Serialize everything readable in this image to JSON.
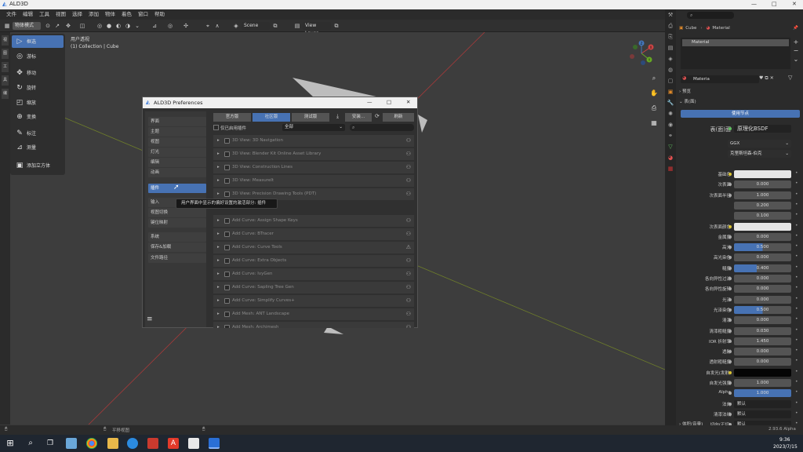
{
  "app": {
    "title": "ALD3D",
    "win_controls": [
      "—",
      "□",
      "✕"
    ]
  },
  "menubar": [
    "文件",
    "编辑",
    "工具",
    "视图",
    "选择",
    "添加",
    "物体",
    "着色",
    "窗口",
    "帮助"
  ],
  "header": {
    "mode": "物体模式",
    "view": "视图",
    "select": "选择",
    "add": "添加",
    "scene": "Scene",
    "view_layer": "View Layer"
  },
  "left_strip": [
    "视",
    "图",
    "工",
    "具",
    "编"
  ],
  "toolbar": [
    {
      "label": "框选",
      "icon": "▷",
      "active": true
    },
    {
      "label": "游标",
      "icon": "◎"
    },
    {
      "label": "移动",
      "icon": "✥"
    },
    {
      "label": "旋转",
      "icon": "↻"
    },
    {
      "label": "缩放",
      "icon": "◰"
    },
    {
      "label": "变换",
      "icon": "⊕"
    },
    {
      "label": "标注",
      "icon": "✎"
    },
    {
      "label": "测量",
      "icon": "⊿"
    },
    {
      "label": "添加立方体",
      "icon": "▣"
    }
  ],
  "viewport": {
    "view_name": "用户透视",
    "collection": "(1) Collection | Cube"
  },
  "gizmo": {
    "x": "X",
    "y": "Y",
    "z": "Z"
  },
  "dialog": {
    "title": "ALD3D Preferences",
    "tabs": [
      "官方版",
      "社区版",
      "测试版"
    ],
    "active_tab": 1,
    "install": "安装...",
    "refresh": "刷新",
    "enabled_only": "仅已启用插件",
    "category": "全部",
    "search_placeholder": "",
    "nav": [
      [
        "界面",
        "主题",
        "视图",
        "灯光",
        "编辑",
        "动画"
      ],
      [
        "插件"
      ],
      [
        "输入",
        "视图切换",
        "键位映射"
      ],
      [
        "系统",
        "保存&加载",
        "文件路径"
      ]
    ],
    "addons": [
      "3D View: 3D Navigation",
      "3D View: Blender Kit Online Asset Library",
      "3D View: Construction Lines",
      "3D View: MeasureIt",
      "3D View: Precision Drawing Tools (PDT)",
      "",
      "Add Curve: Assign Shape Keys",
      "Add Curve: BTracer",
      "Add Curve: Curve Tools",
      "Add Curve: Extra Objects",
      "Add Curve: IvyGen",
      "Add Curve: Sapling Tree Gen",
      "Add Curve: Simplify Curves+",
      "Add Mesh: ANT Landscape",
      "Add Mesh: Archimesh"
    ],
    "tooltip": "用户界面中显示的偏好设置的激活部分: 插件",
    "menu_icon": "≡"
  },
  "props": {
    "object": "Cube",
    "material_tab": "Material",
    "slot": "Material",
    "mat_name": "Materia",
    "sections": {
      "preview": "预览",
      "surface": "表(面)"
    },
    "use_nodes": "使用节点",
    "surface_label": "表(面)面",
    "surface_value": "原理化BSDF",
    "dist": "GGX",
    "subsurf_method": "克里斯坦森-伯克",
    "rows": [
      {
        "label": "基础色",
        "type": "white",
        "dot": "y"
      },
      {
        "label": "次表面",
        "value": "0.000",
        "fill": 0
      },
      {
        "label": "次表面半径",
        "value": "1.000",
        "fill": 0
      },
      {
        "label": "",
        "value": "0.200",
        "fill": 0
      },
      {
        "label": "",
        "value": "0.100",
        "fill": 0
      },
      {
        "label": "次表面颜色",
        "type": "white",
        "dot": "y"
      },
      {
        "label": "金属度",
        "value": "0.000",
        "fill": 0
      },
      {
        "label": "高光",
        "value": "0.500",
        "fill": 0.5
      },
      {
        "label": "高光染色",
        "value": "0.000",
        "fill": 0
      },
      {
        "label": "糙度",
        "value": "0.400",
        "fill": 0.4
      },
      {
        "label": "各向异性过滤",
        "value": "0.000",
        "fill": 0
      },
      {
        "label": "各向异性旋转",
        "value": "0.000",
        "fill": 0
      },
      {
        "label": "光泽",
        "value": "0.000",
        "fill": 0
      },
      {
        "label": "光泽染色",
        "value": "0.500",
        "fill": 0.5
      },
      {
        "label": "清漆",
        "value": "0.000",
        "fill": 0
      },
      {
        "label": "清漆粗糙度",
        "value": "0.030",
        "fill": 0
      },
      {
        "label": "IOR 折射率",
        "value": "1.450",
        "fill": 0
      },
      {
        "label": "透射",
        "value": "0.000",
        "fill": 0
      },
      {
        "label": "透射粗糙度",
        "value": "0.000",
        "fill": 0
      },
      {
        "label": "自发光(发射)",
        "type": "black",
        "dot": "y"
      },
      {
        "label": "自发光强度",
        "value": "1.000",
        "fill": 0
      },
      {
        "label": "Alpha",
        "value": "1.000",
        "fill": 1
      },
      {
        "label": "法向",
        "value": "默认",
        "type": "dark"
      },
      {
        "label": "清漆法线",
        "value": "默认",
        "type": "dark"
      },
      {
        "label": "切向(正切)",
        "value": "默认",
        "type": "dark"
      }
    ],
    "volume": "体积(音量)"
  },
  "status": {
    "left": "",
    "middle": "平移视图",
    "version": "2.93.6 Alpha"
  },
  "taskbar": {
    "time": "9:36",
    "date": "2023/7/15"
  }
}
